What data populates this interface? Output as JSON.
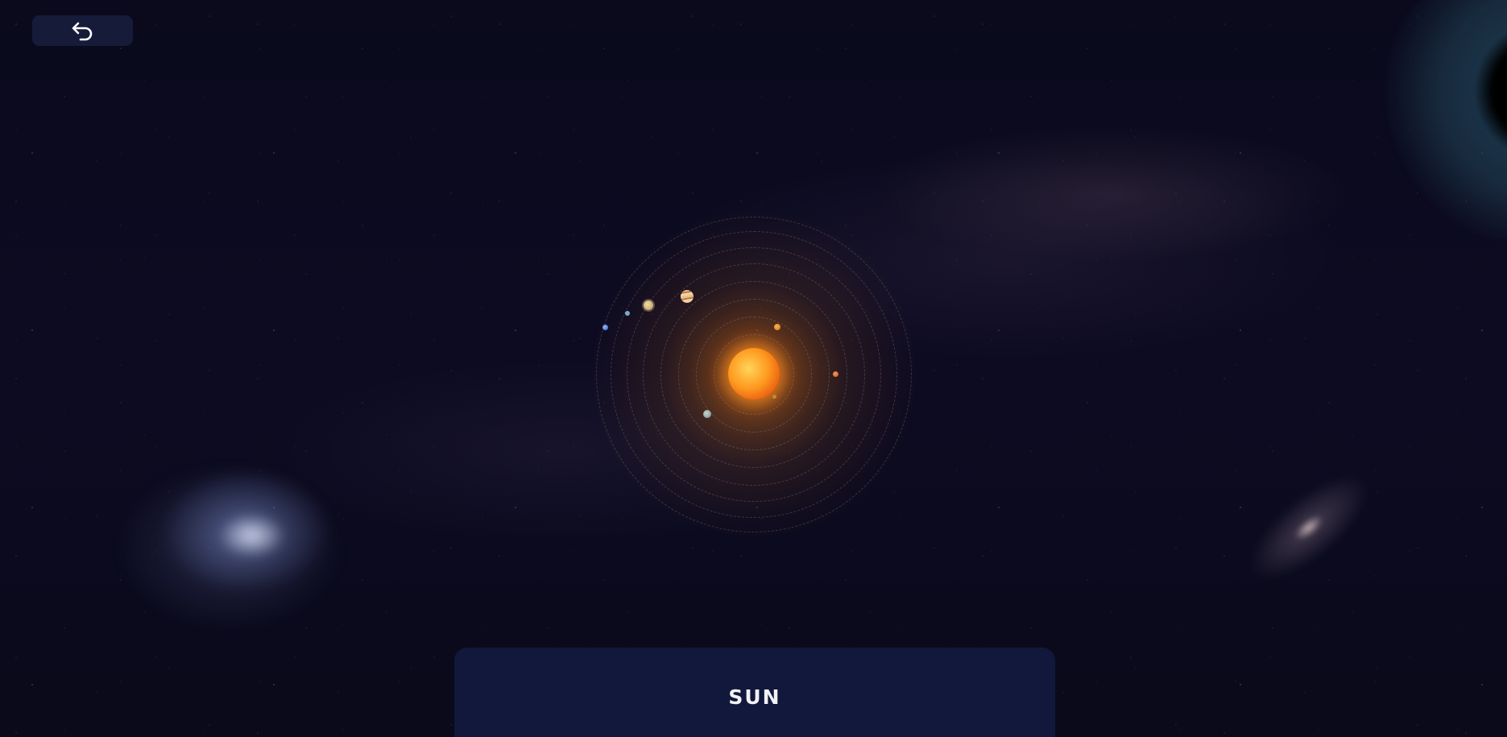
{
  "toolbar": {
    "back_icon": "undo-arrow-icon"
  },
  "solar_system": {
    "center_body": "sun",
    "planets": [
      {
        "name": "mercury",
        "color": "#c9882e"
      },
      {
        "name": "venus",
        "color": "#d27a3a"
      },
      {
        "name": "earth",
        "color": "#6f8aa3"
      },
      {
        "name": "mars",
        "color": "#b86a3a"
      },
      {
        "name": "jupiter",
        "color": "#d9a56e"
      },
      {
        "name": "saturn",
        "color": "#d8c08a"
      },
      {
        "name": "uranus",
        "color": "#7fa9c4"
      },
      {
        "name": "neptune",
        "color": "#5b86c9"
      }
    ]
  },
  "panel": {
    "title": "SUN"
  },
  "colors": {
    "background": "#0b0a1f",
    "button_bg": "#161b3a",
    "panel_bg": "#121a3e",
    "sun": "#ff9a1f"
  }
}
